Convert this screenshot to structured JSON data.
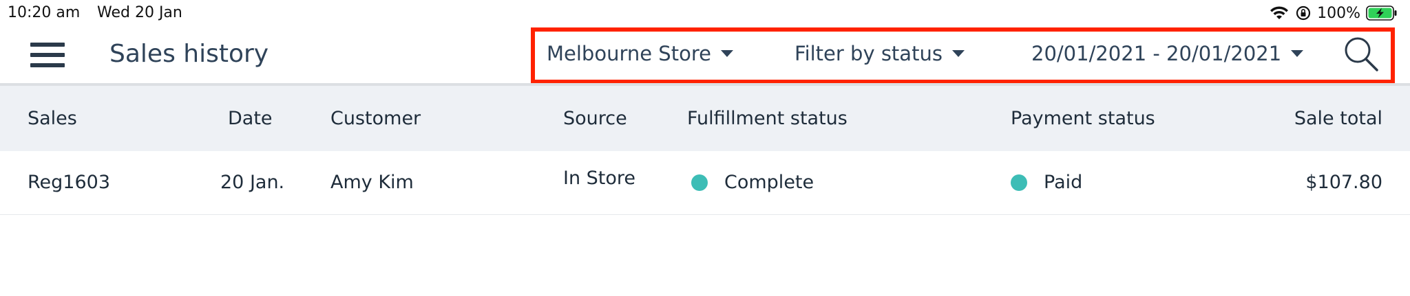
{
  "status_bar": {
    "time": "10:20 am",
    "date": "Wed 20 Jan",
    "battery": "100%"
  },
  "header": {
    "title": "Sales history",
    "store_filter": "Melbourne Store",
    "status_filter": "Filter by status",
    "date_range": "20/01/2021 - 20/01/2021"
  },
  "table": {
    "columns": {
      "sales": "Sales",
      "date": "Date",
      "customer": "Customer",
      "source": "Source",
      "fulfillment": "Fulfillment status",
      "payment": "Payment status",
      "total": "Sale total"
    },
    "rows": [
      {
        "sale": "Reg1603",
        "date": "20 Jan.",
        "customer": "Amy Kim",
        "source": "In Store",
        "fulfillment": "Complete",
        "payment": "Paid",
        "total": "$107.80"
      }
    ]
  },
  "colors": {
    "status_dot": "#3dbdb6",
    "highlight_border": "#ff2200",
    "header_band": "#eef1f5",
    "text_primary": "#2f4359"
  },
  "icons": [
    "menu-icon",
    "search-icon",
    "caret-down-icon",
    "wifi-icon",
    "orientation-lock-icon",
    "battery-charging-icon"
  ]
}
